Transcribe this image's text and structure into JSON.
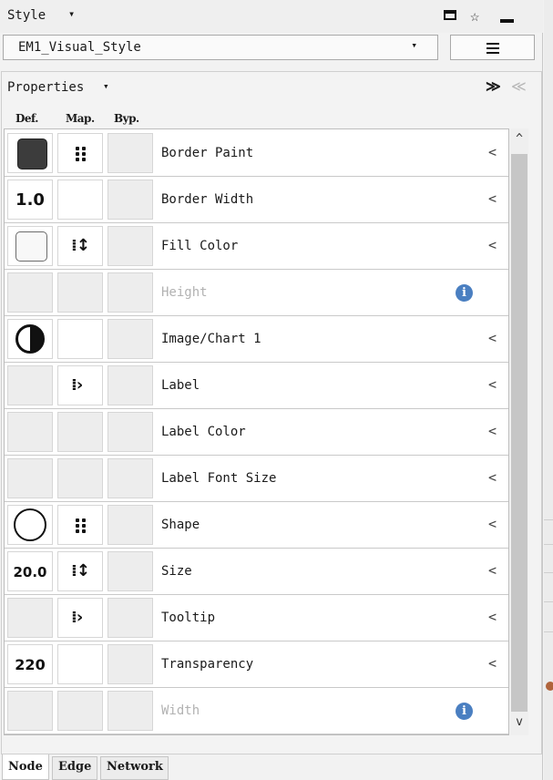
{
  "window": {
    "title": "Style",
    "title_caret": "▾",
    "pin_glyph": "☆"
  },
  "style_selector": {
    "value": "EM1_Visual_Style",
    "arrow": "▾"
  },
  "properties": {
    "label": "Properties",
    "caret": "▾",
    "expand_glyph": "≫",
    "collapse_glyph": "≪",
    "columns": [
      "Def.",
      "Map.",
      "Byp."
    ]
  },
  "rows": [
    {
      "name": "Border Paint",
      "enabled": true,
      "def_icon": "dark-color-swatch",
      "map_icon": "discrete-mapping-icon",
      "action": "chevron-left-icon"
    },
    {
      "name": "Border Width",
      "enabled": true,
      "def_value": "1.0",
      "map_icon": "",
      "action": "chevron-left-icon"
    },
    {
      "name": "Fill Color",
      "enabled": true,
      "def_icon": "light-color-swatch",
      "map_icon": "continuous-mapping-icon",
      "action": "chevron-left-icon"
    },
    {
      "name": "Height",
      "enabled": false,
      "action": "info-icon"
    },
    {
      "name": "Image/Chart 1",
      "enabled": true,
      "def_icon": "half-circle-icon",
      "action": "chevron-left-icon"
    },
    {
      "name": "Label",
      "enabled": true,
      "map_icon": "passthrough-mapping-icon",
      "action": "chevron-left-icon"
    },
    {
      "name": "Label Color",
      "enabled": true,
      "action": "chevron-left-icon"
    },
    {
      "name": "Label Font Size",
      "enabled": true,
      "action": "chevron-left-icon"
    },
    {
      "name": "Shape",
      "enabled": true,
      "def_icon": "circle-shape-icon",
      "map_icon": "discrete-mapping-icon",
      "action": "chevron-left-icon"
    },
    {
      "name": "Size",
      "enabled": true,
      "def_value": "20.0",
      "map_icon": "continuous-mapping-icon",
      "action": "chevron-left-icon"
    },
    {
      "name": "Tooltip",
      "enabled": true,
      "map_icon": "passthrough-mapping-icon",
      "action": "chevron-left-icon"
    },
    {
      "name": "Transparency",
      "enabled": true,
      "def_value": "220",
      "action": "chevron-left-icon"
    },
    {
      "name": "Width",
      "enabled": false,
      "action": "info-icon"
    }
  ],
  "glyphs": {
    "chevron": "<",
    "info": "i",
    "continuous": "⁞↕",
    "passthrough": "⁞›",
    "scroll_up": "^",
    "scroll_down": "v"
  },
  "tabs": [
    {
      "label": "Node",
      "active": true
    },
    {
      "label": "Edge",
      "active": false
    },
    {
      "label": "Network",
      "active": false
    }
  ]
}
